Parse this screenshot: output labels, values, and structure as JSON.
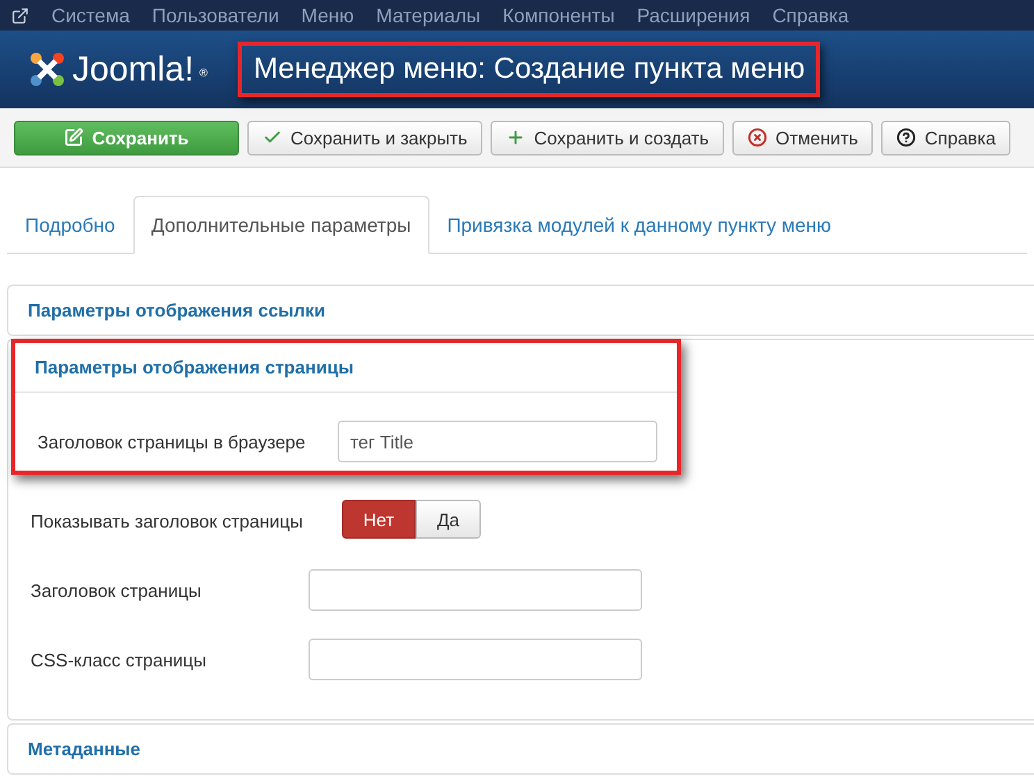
{
  "menu_bar": {
    "items": [
      "Система",
      "Пользователи",
      "Меню",
      "Материалы",
      "Компоненты",
      "Расширения",
      "Справка"
    ]
  },
  "header": {
    "logo": {
      "text": "Joomla!",
      "mark": "®"
    },
    "title": "Менеджер меню: Создание пункта меню",
    "highlighted": true
  },
  "toolbar": [
    {
      "label": "Сохранить",
      "kind": "save"
    },
    {
      "label": "Сохранить и закрыть",
      "kind": "close"
    },
    {
      "label": "Сохранить и создать",
      "kind": "create"
    },
    {
      "label": "Отменить",
      "kind": "cancel"
    },
    {
      "label": "Справка",
      "kind": "help"
    }
  ],
  "tabs": [
    {
      "label": "Подробно",
      "selected": false
    },
    {
      "label": "Дополнительные параметры",
      "selected": true
    },
    {
      "label": "Привязка модулей к данному пункту меню",
      "selected": false
    }
  ],
  "panels": [
    {
      "title": "Параметры отображения ссылки",
      "expanded": false
    },
    {
      "title": "Параметры отображения страницы",
      "expanded": true,
      "highlighted": true,
      "fields": [
        {
          "kind": "text",
          "label": "Заголовок страницы в браузере",
          "value": "тег Title"
        },
        {
          "kind": "toggle",
          "label": "Показывать заголовок страницы",
          "options": [
            {
              "label": "Нет",
              "selected": true
            },
            {
              "label": "Да",
              "selected": false
            }
          ]
        },
        {
          "kind": "text",
          "label": "Заголовок страницы"
        },
        {
          "kind": "text",
          "label": "CSS-класс страницы"
        }
      ]
    },
    {
      "title": "Метаданные",
      "expanded": false
    }
  ]
}
